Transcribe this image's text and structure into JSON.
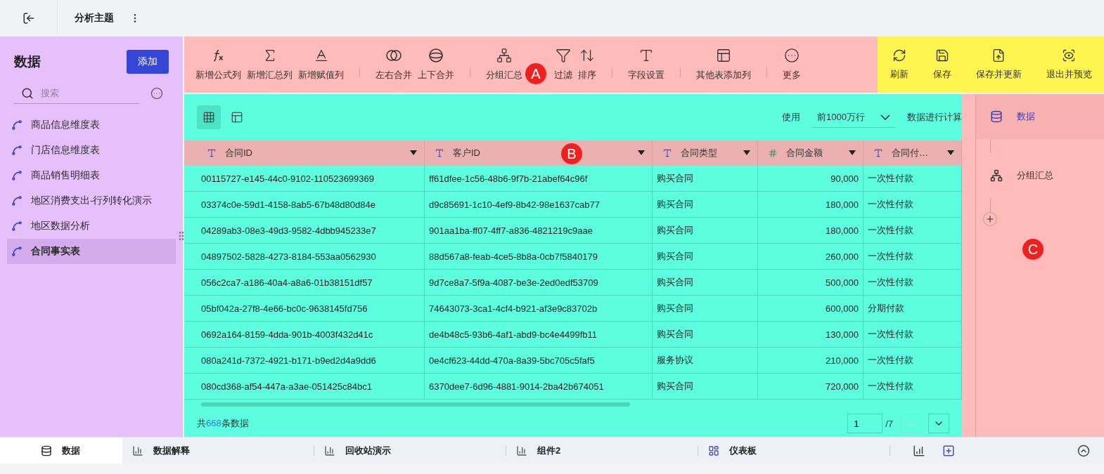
{
  "header": {
    "title": "分析主题"
  },
  "sidebar": {
    "title": "数据",
    "add_button": "添加",
    "search": {
      "placeholder": "搜索"
    },
    "items": [
      {
        "label": "商品信息维度表",
        "selected": false
      },
      {
        "label": "门店信息维度表",
        "selected": false
      },
      {
        "label": "商品销售明细表",
        "selected": false
      },
      {
        "label": "地区消费支出-行列转化演示",
        "selected": false
      },
      {
        "label": "地区数据分析",
        "selected": false
      },
      {
        "label": "合同事实表",
        "selected": true
      }
    ]
  },
  "toolbar": {
    "groups": [
      [
        {
          "label": "新增公式列"
        },
        {
          "label": "新增汇总列"
        },
        {
          "label": "新增赋值列"
        }
      ],
      [
        {
          "label": "左右合并"
        },
        {
          "label": "上下合并"
        }
      ],
      [
        {
          "label": "分组汇总"
        }
      ],
      [
        {
          "label": "过滤"
        },
        {
          "label": "排序"
        }
      ],
      [
        {
          "label": "字段设置"
        }
      ],
      [
        {
          "label": "其他表添加列"
        }
      ],
      [
        {
          "label": "更多"
        }
      ]
    ],
    "actions": [
      {
        "label": "刷新"
      },
      {
        "label": "保存"
      },
      {
        "label": "保存并更新"
      },
      {
        "label": "退出并预览"
      }
    ]
  },
  "markers": [
    "A",
    "B",
    "C"
  ],
  "view_switch": [
    {
      "kind": "grid",
      "selected": true
    },
    {
      "kind": "layout",
      "selected": false
    }
  ],
  "row_limit": {
    "prefix": "使用",
    "value": "前1000万行",
    "suffix": "数据进行计算"
  },
  "table": {
    "columns": [
      {
        "label": "合同ID",
        "kind": "text"
      },
      {
        "label": "客户ID",
        "kind": "text"
      },
      {
        "label": "合同类型",
        "kind": "text"
      },
      {
        "label": "合同金额",
        "kind": "number"
      },
      {
        "label": "合同付…",
        "kind": "text"
      }
    ],
    "rows": [
      [
        "00115727-e145-44c0-9102-110523699369",
        "ff61dfee-1c56-48b6-9f7b-21abef64c96f",
        "购买合同",
        "90,000",
        "一次性付款"
      ],
      [
        "03374c0e-59d1-4158-8ab5-67b48d80d84e",
        "d9c85691-1c10-4ef9-8b42-98e1637cab77",
        "购买合同",
        "180,000",
        "一次性付款"
      ],
      [
        "04289ab3-08e3-49d3-9582-4dbb945233e7",
        "901aa1ba-ff07-4ff7-a836-4821219c9aae",
        "购买合同",
        "180,000",
        "一次性付款"
      ],
      [
        "04897502-5828-4273-8184-553aa0562930",
        "88d567a8-feab-4ce5-8b8a-0cb7f5840179",
        "购买合同",
        "260,000",
        "一次性付款"
      ],
      [
        "056c2ca7-a186-40a4-a8a6-01b38151df57",
        "9d7ce8a7-5f9a-4087-be3e-2ed0edf53709",
        "购买合同",
        "500,000",
        "一次性付款"
      ],
      [
        "05bf042a-27f8-4e66-bc0c-9638145fd756",
        "74643073-3ca1-4cf4-b921-af3e9c83702b",
        "购买合同",
        "600,000",
        "分期付款"
      ],
      [
        "0692a164-8159-4dda-901b-4003f432d41c",
        "de4b48c5-93b6-4af1-abd9-bc4e4499fb11",
        "购买合同",
        "130,000",
        "一次性付款"
      ],
      [
        "080a241d-7372-4921-b171-b9ed2d4a9dd6",
        "0e4cf623-44dd-470a-8a39-5bc705c5faf5",
        "服务协议",
        "210,000",
        "一次性付款"
      ],
      [
        "080cd368-af54-447a-a3ae-051425c84bc1",
        "6370dee7-6d96-4881-9014-2ba42b674051",
        "购买合同",
        "720,000",
        "一次性付款"
      ]
    ]
  },
  "footer": {
    "prefix": "共",
    "count": "668",
    "suffix": "条数据",
    "page": "1",
    "pages": "/7",
    "prev_disabled": true
  },
  "flow": {
    "nodes": [
      {
        "label": "数据",
        "kind": "source",
        "selected": true
      },
      {
        "label": "分组汇总",
        "kind": "group",
        "selected": false
      }
    ]
  },
  "tabs": [
    {
      "label": "数据",
      "kind": "data",
      "selected": true
    },
    {
      "label": "数据解释",
      "kind": "chart",
      "selected": false
    },
    {
      "label": "回收站演示",
      "kind": "chart",
      "selected": false
    },
    {
      "label": "组件2",
      "kind": "chart",
      "selected": false
    },
    {
      "label": "仪表板",
      "kind": "dashboard",
      "selected": false
    }
  ]
}
